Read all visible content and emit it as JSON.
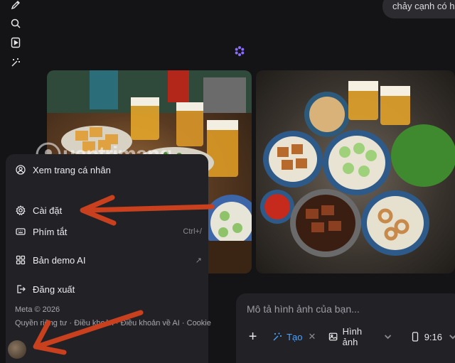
{
  "top_bubble": {
    "text": "chảy cạnh có h"
  },
  "rail": {
    "icons": [
      "edit-icon",
      "search-icon",
      "play-square-icon",
      "magic-wand-icon"
    ]
  },
  "watermark": {
    "text": "uantrimang"
  },
  "menu": {
    "items": [
      {
        "label": "Xem trang cá nhân",
        "icon": "profile-icon",
        "shortcut": ""
      },
      {
        "label": "Cài đặt",
        "icon": "gear-icon",
        "shortcut": ""
      },
      {
        "label": "Phím tắt",
        "icon": "keyboard-icon",
        "shortcut": "Ctrl+/"
      },
      {
        "label": "Bản demo AI",
        "icon": "grid-icon",
        "shortcut": "↗"
      },
      {
        "label": "Đăng xuất",
        "icon": "logout-icon",
        "shortcut": ""
      }
    ],
    "copyright": "Meta © 2026",
    "links": [
      "Quyền riêng tư",
      "Điều khoản",
      "Điều khoản về AI",
      "Cookie"
    ]
  },
  "prompt": {
    "placeholder": "Mô tả hình ảnh của bạn...",
    "create_label": "Tạo",
    "image_label": "Hình ảnh",
    "ratio_label": "9:16"
  },
  "colors": {
    "background": "#141416",
    "panel": "#222226",
    "accent_blue": "#4aa3ff",
    "arrow": "#c8401e"
  }
}
